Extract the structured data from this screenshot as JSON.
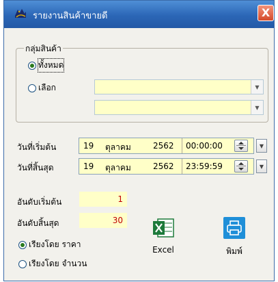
{
  "window": {
    "title": "รายงานสินค้าขายดี",
    "close_symbol": "X"
  },
  "product_group": {
    "legend": "กลุ่มสินค้า",
    "options": [
      {
        "label": "ทั้งหมด",
        "checked": true
      },
      {
        "label": "เลือก",
        "checked": false
      }
    ]
  },
  "start_date": {
    "label": "วันที่เริ่มต้น",
    "day": "19",
    "month": "ตุลาคม",
    "year": "2562",
    "time": "00:00:00"
  },
  "end_date": {
    "label": "วันที่สิ้นสุด",
    "day": "19",
    "month": "ตุลาคม",
    "year": "2562",
    "time": "23:59:59"
  },
  "rank_start": {
    "label": "อันดับเริ่มต้น",
    "value": "1"
  },
  "rank_end": {
    "label": "อันดับสิ้นสุด",
    "value": "30"
  },
  "sort": {
    "options": [
      {
        "label": "เรียงโดย ราคา",
        "checked": true
      },
      {
        "label": "เรียงโดย จำนวน",
        "checked": false
      }
    ]
  },
  "actions": {
    "excel_label": "Excel",
    "excel_icon": "excel-icon",
    "print_label": "พิมพ์",
    "print_icon": "printer-icon"
  },
  "colors": {
    "field_bg": "#ffffc8",
    "rank_value": "#c00000",
    "titlebar": "#2b66b6",
    "close": "#d44a2a",
    "print_icon_bg": "#1f8fd8",
    "excel_green": "#1d7a3a"
  }
}
